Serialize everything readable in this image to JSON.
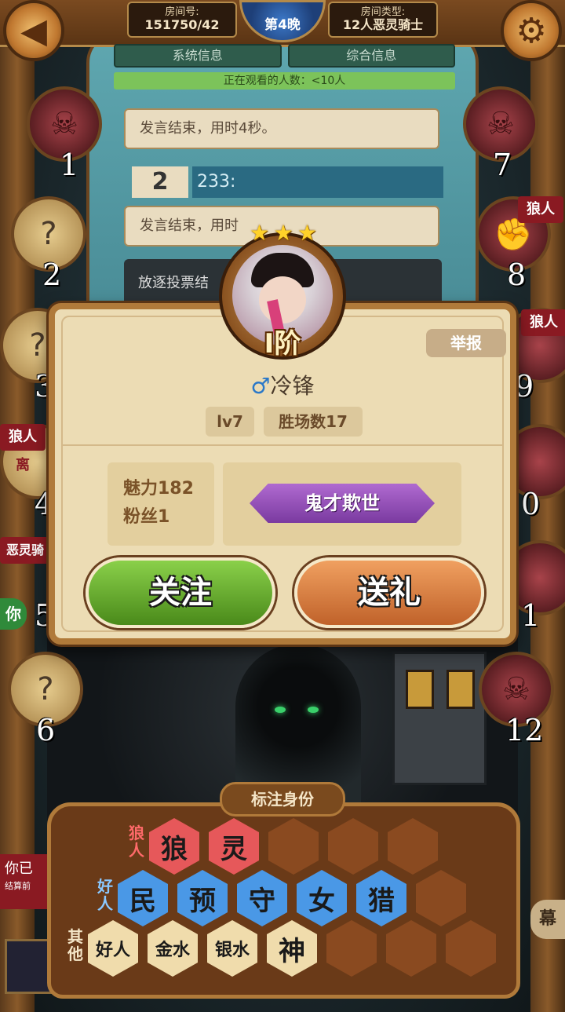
{
  "topbar": {
    "room_number_label": "房间号:",
    "room_number": "151750/42",
    "night": "第4晚",
    "room_type_label": "房间类型:",
    "room_type": "12人恶灵骑士",
    "back_icon": "back-arrow-icon",
    "settings_icon": "gear-icon"
  },
  "tabs": [
    "系统信息",
    "综合信息"
  ],
  "watchers": "正在观看的人数：<10人",
  "chat": {
    "speech1": "发言结束，用时4秒。",
    "speaker_num": "2",
    "speaker_text": "233:",
    "speech2": "发言结束，用时",
    "vote_text": "放逐投票结"
  },
  "seats": [
    {
      "num": "1",
      "state": "dead"
    },
    {
      "num": "2",
      "state": "unknown"
    },
    {
      "num": "3",
      "state": "unknown"
    },
    {
      "num": "4",
      "state": "unknown"
    },
    {
      "num": "5",
      "state": "self"
    },
    {
      "num": "6",
      "state": "unknown"
    },
    {
      "num": "7",
      "state": "dead"
    },
    {
      "num": "8",
      "state": "wolf"
    },
    {
      "num": "9",
      "state": "wolf"
    },
    {
      "num": "0",
      "state": "dead"
    },
    {
      "num": "1",
      "state": "dead"
    },
    {
      "num": "12",
      "state": "dead"
    }
  ],
  "role_tags": {
    "seat8": "狼人",
    "seat9": "狼人",
    "seat4_top": "狼人",
    "seat4_sub": "离",
    "seat5": "恶灵骑",
    "you": "你"
  },
  "left_notice": {
    "line1": "你已",
    "line2": "结算前"
  },
  "right_button": "幕",
  "profile": {
    "rank": "I阶",
    "stars": 3,
    "report": "举报",
    "gender_symbol": "♂",
    "name": "冷锋",
    "level": "lv7",
    "wins": "胜场数17",
    "charm": "魅力182",
    "fans": "粉丝1",
    "title": "鬼才欺世",
    "follow": "关注",
    "gift": "送礼"
  },
  "mark_panel": {
    "title": "标注身份",
    "wolf_label": "狼人",
    "good_label": "好人",
    "other_label": "其他",
    "wolf_roles": [
      "狼",
      "灵"
    ],
    "good_roles": [
      "民",
      "预",
      "守",
      "女",
      "猎"
    ],
    "other_roles": [
      "好人",
      "金水",
      "银水",
      "神"
    ]
  },
  "colors": {
    "wolf": "#e6585a",
    "good": "#4a98e6",
    "follow": "#6aac2e",
    "gift": "#d8783e",
    "title_banner": "#9a52c0"
  }
}
